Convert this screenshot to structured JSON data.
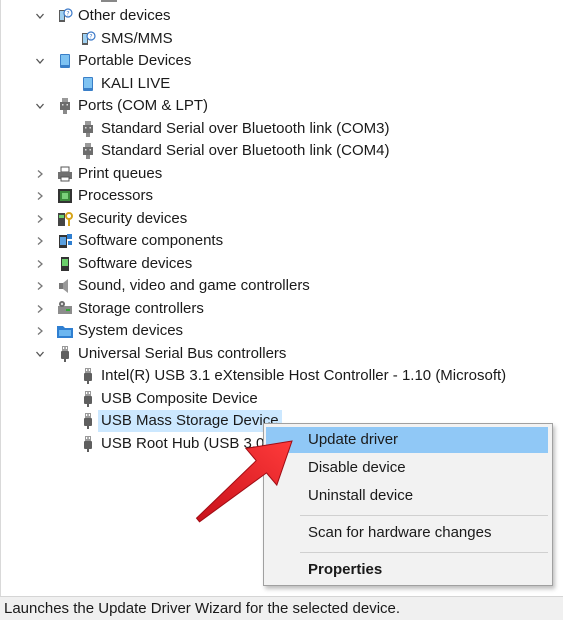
{
  "tree": [
    {
      "label": "Other devices",
      "level": 0,
      "state": "expanded",
      "icon": "unknown-device-icon"
    },
    {
      "label": "SMS/MMS",
      "level": 1,
      "icon": "unknown-device-icon"
    },
    {
      "label": "Portable Devices",
      "level": 0,
      "state": "expanded",
      "icon": "portable-device-icon"
    },
    {
      "label": "KALI LIVE",
      "level": 1,
      "icon": "portable-device-icon"
    },
    {
      "label": "Ports (COM & LPT)",
      "level": 0,
      "state": "expanded",
      "icon": "port-icon"
    },
    {
      "label": "Standard Serial over Bluetooth link (COM3)",
      "level": 1,
      "icon": "port-icon"
    },
    {
      "label": "Standard Serial over Bluetooth link (COM4)",
      "level": 1,
      "icon": "port-icon"
    },
    {
      "label": "Print queues",
      "level": 0,
      "state": "collapsed",
      "icon": "printer-icon"
    },
    {
      "label": "Processors",
      "level": 0,
      "state": "collapsed",
      "icon": "processor-icon"
    },
    {
      "label": "Security devices",
      "level": 0,
      "state": "collapsed",
      "icon": "security-device-icon"
    },
    {
      "label": "Software components",
      "level": 0,
      "state": "collapsed",
      "icon": "software-component-icon"
    },
    {
      "label": "Software devices",
      "level": 0,
      "state": "collapsed",
      "icon": "software-device-icon"
    },
    {
      "label": "Sound, video and game controllers",
      "level": 0,
      "state": "collapsed",
      "icon": "speaker-icon"
    },
    {
      "label": "Storage controllers",
      "level": 0,
      "state": "collapsed",
      "icon": "storage-controller-icon"
    },
    {
      "label": "System devices",
      "level": 0,
      "state": "collapsed",
      "icon": "system-folder-icon"
    },
    {
      "label": "Universal Serial Bus controllers",
      "level": 0,
      "state": "expanded",
      "icon": "usb-icon"
    },
    {
      "label": "Intel(R) USB 3.1 eXtensible Host Controller - 1.10 (Microsoft)",
      "level": 1,
      "icon": "usb-icon"
    },
    {
      "label": "USB Composite Device",
      "level": 1,
      "icon": "usb-icon"
    },
    {
      "label": "USB Mass Storage Device",
      "level": 1,
      "icon": "usb-icon",
      "selected": true
    },
    {
      "label": "USB Root Hub (USB 3.0)",
      "level": 1,
      "icon": "usb-icon"
    }
  ],
  "context_menu": {
    "items": [
      {
        "label": "Update driver",
        "highlighted": true
      },
      {
        "label": "Disable device"
      },
      {
        "label": "Uninstall device"
      },
      {
        "separator": true
      },
      {
        "label": "Scan for hardware changes"
      },
      {
        "separator": true
      },
      {
        "label": "Properties",
        "bold": true
      }
    ]
  },
  "statusbar": {
    "text": "Launches the Update Driver Wizard for the selected device."
  },
  "colors": {
    "selection": "#cce8ff",
    "menu_highlight": "#90c8f6",
    "arrow": "#e8202a",
    "menu_bg": "#f2f2f2"
  }
}
